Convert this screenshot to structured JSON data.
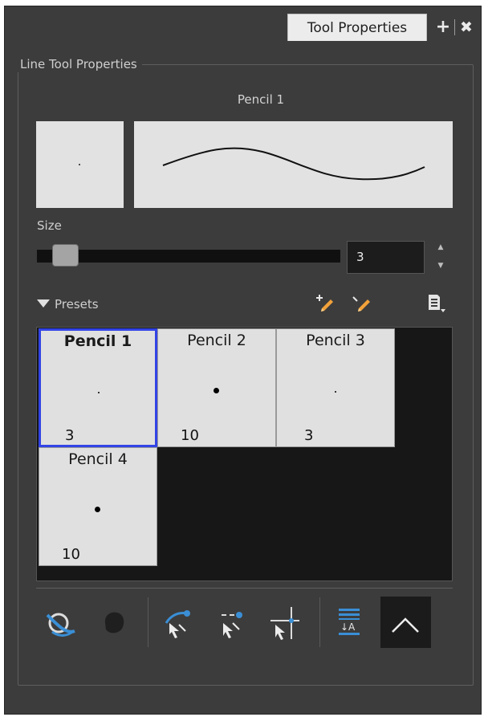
{
  "window": {
    "tab_label": "Tool Properties",
    "add_label": "+",
    "close_label": "✖"
  },
  "group": {
    "title": "Line Tool Properties",
    "tool_name": "Pencil 1"
  },
  "size": {
    "label": "Size",
    "value": "3",
    "slider_fraction": 0.03
  },
  "presets": {
    "label": "Presets",
    "items": [
      {
        "name": "Pencil 1",
        "size": "3",
        "selected": true
      },
      {
        "name": "Pencil 2",
        "size": "10",
        "selected": false
      },
      {
        "name": "Pencil 3",
        "size": "3",
        "selected": false
      },
      {
        "name": "Pencil 4",
        "size": "10",
        "selected": false
      }
    ]
  },
  "icons": {
    "new_preset": "new-preset-icon",
    "rename_preset": "rename-preset-icon",
    "preset_menu": "preset-menu-icon",
    "auto_flatten": "auto-flatten-icon",
    "shape_fill": "shape-fill-icon",
    "snap_contour": "snap-contour-icon",
    "snap_line_ends": "snap-line-ends-icon",
    "snap_align": "snap-align-icon",
    "stroke_order": "stroke-order-icon",
    "join_mode": "join-mode-icon"
  },
  "colors": {
    "panel_bg": "#3c3c3c",
    "selection_border": "#3344e6",
    "accent_blue": "#3a8fd6",
    "orange": "#f2a23a"
  }
}
